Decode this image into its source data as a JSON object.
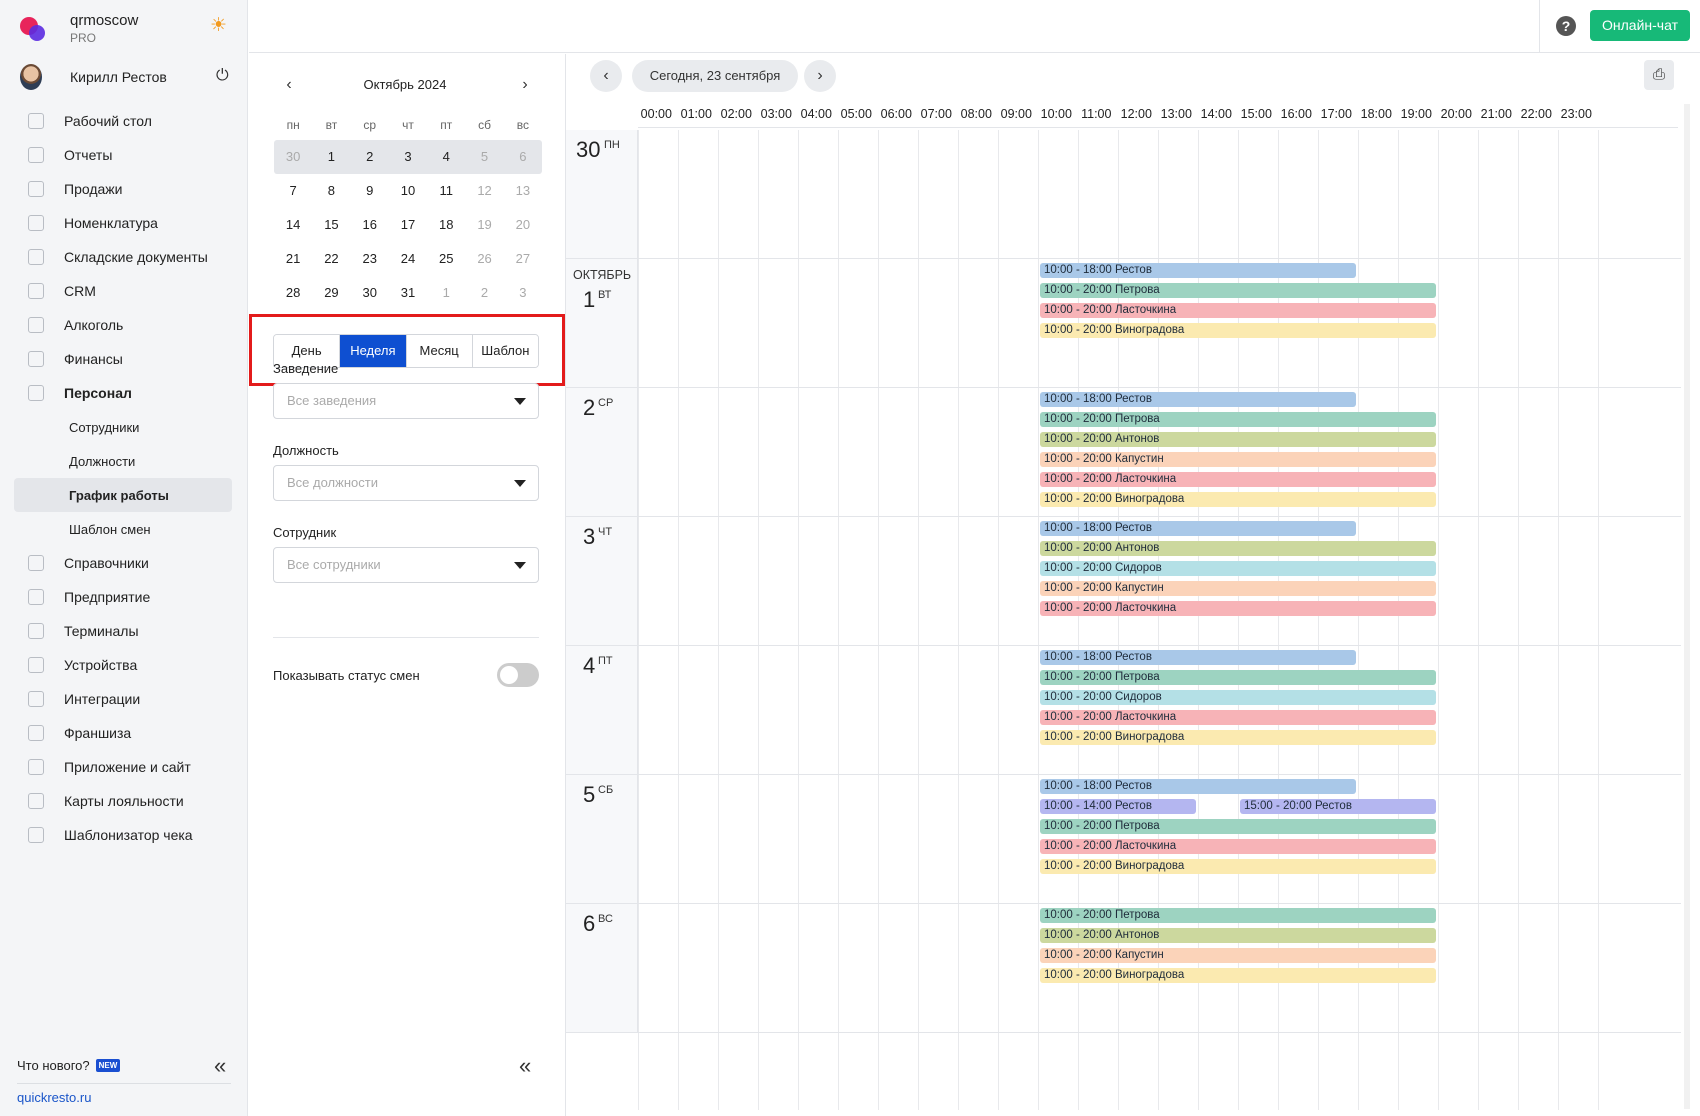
{
  "brand": {
    "name": "qrmoscow",
    "plan": "PRO"
  },
  "user": {
    "name": "Кирилл Рестов"
  },
  "nav": [
    {
      "label": "Рабочий стол",
      "icon": "dashboard-icon"
    },
    {
      "label": "Отчеты",
      "icon": "reports-icon"
    },
    {
      "label": "Продажи",
      "icon": "sales-icon"
    },
    {
      "label": "Номенклатура",
      "icon": "nomenclature-icon"
    },
    {
      "label": "Складские документы",
      "icon": "warehouse-icon"
    },
    {
      "label": "CRM",
      "icon": "crm-icon"
    },
    {
      "label": "Алкоголь",
      "icon": "alcohol-icon"
    },
    {
      "label": "Финансы",
      "icon": "finance-icon"
    },
    {
      "label": "Персонал",
      "icon": "staff-icon",
      "bold": true
    }
  ],
  "nav_sub": [
    {
      "label": "Сотрудники"
    },
    {
      "label": "Должности"
    },
    {
      "label": "График работы",
      "active": true
    },
    {
      "label": "Шаблон смен"
    }
  ],
  "nav2": [
    {
      "label": "Справочники",
      "icon": "directory-icon"
    },
    {
      "label": "Предприятие",
      "icon": "enterprise-icon"
    },
    {
      "label": "Терминалы",
      "icon": "terminal-icon"
    },
    {
      "label": "Устройства",
      "icon": "printer-icon"
    },
    {
      "label": "Интеграции",
      "icon": "integration-icon"
    },
    {
      "label": "Франшиза",
      "icon": "franchise-icon"
    },
    {
      "label": "Приложение и сайт",
      "icon": "app-icon"
    },
    {
      "label": "Карты лояльности",
      "icon": "loyalty-icon"
    },
    {
      "label": "Шаблонизатор чека",
      "icon": "receipt-icon"
    }
  ],
  "footer": {
    "whats_new": "Что нового?",
    "new_badge": "NEW",
    "link": "quickresto.ru",
    "collapse": "«"
  },
  "topbar": {
    "help": "?",
    "chat": "Онлайн-чат"
  },
  "calendar": {
    "title": "Октябрь 2024",
    "prev": "‹",
    "next": "›",
    "dow": [
      "пн",
      "вт",
      "ср",
      "чт",
      "пт",
      "сб",
      "вс"
    ],
    "weeks": [
      {
        "sel": true,
        "days": [
          {
            "d": "30",
            "m": true
          },
          {
            "d": "1"
          },
          {
            "d": "2"
          },
          {
            "d": "3"
          },
          {
            "d": "4"
          },
          {
            "d": "5",
            "m": true
          },
          {
            "d": "6",
            "m": true
          }
        ]
      },
      {
        "days": [
          {
            "d": "7"
          },
          {
            "d": "8"
          },
          {
            "d": "9"
          },
          {
            "d": "10"
          },
          {
            "d": "11"
          },
          {
            "d": "12",
            "m": true
          },
          {
            "d": "13",
            "m": true
          }
        ]
      },
      {
        "days": [
          {
            "d": "14"
          },
          {
            "d": "15"
          },
          {
            "d": "16"
          },
          {
            "d": "17"
          },
          {
            "d": "18"
          },
          {
            "d": "19",
            "m": true
          },
          {
            "d": "20",
            "m": true
          }
        ]
      },
      {
        "days": [
          {
            "d": "21"
          },
          {
            "d": "22"
          },
          {
            "d": "23"
          },
          {
            "d": "24"
          },
          {
            "d": "25"
          },
          {
            "d": "26",
            "m": true
          },
          {
            "d": "27",
            "m": true
          }
        ]
      },
      {
        "days": [
          {
            "d": "28"
          },
          {
            "d": "29"
          },
          {
            "d": "30"
          },
          {
            "d": "31"
          },
          {
            "d": "1",
            "m": true
          },
          {
            "d": "2",
            "m": true
          },
          {
            "d": "3",
            "m": true
          }
        ]
      }
    ]
  },
  "views": [
    {
      "label": "День"
    },
    {
      "label": "Неделя",
      "active": true
    },
    {
      "label": "Месяц"
    },
    {
      "label": "Шаблон"
    }
  ],
  "filters": {
    "venue_label": "Заведение",
    "venue_placeholder": "Все заведения",
    "position_label": "Должность",
    "position_placeholder": "Все должности",
    "employee_label": "Сотрудник",
    "employee_placeholder": "Все сотрудники",
    "toggle_label": "Показывать статус смен",
    "toggle_on": false
  },
  "schedule": {
    "today": "Сегодня, 23 сентября",
    "prev": "‹",
    "next": "›",
    "print": "⎙",
    "hours": [
      "00:00",
      "01:00",
      "02:00",
      "03:00",
      "04:00",
      "05:00",
      "06:00",
      "07:00",
      "08:00",
      "09:00",
      "10:00",
      "11:00",
      "12:00",
      "13:00",
      "14:00",
      "15:00",
      "16:00",
      "17:00",
      "18:00",
      "19:00",
      "20:00",
      "21:00",
      "22:00",
      "23:00"
    ],
    "colors": {
      "blue": "#a9c8e8",
      "green": "#9dd3c1",
      "red": "#f7b3b7",
      "yellow": "#fbeab0",
      "olive": "#ccd89e",
      "peach": "#fbd3b9",
      "cyan": "#b4e0e6",
      "purple": "#b4b6f0"
    },
    "days": [
      {
        "num": "30",
        "dow": "ПН",
        "month": "",
        "shifts": []
      },
      {
        "num": "1",
        "dow": "ВТ",
        "month": "ОКТЯБРЬ",
        "shifts": [
          {
            "text": "10:00 - 18:00 Рестов",
            "start": 10,
            "end": 18,
            "color": "blue"
          },
          {
            "text": "10:00 - 20:00 Петрова",
            "start": 10,
            "end": 20,
            "color": "green"
          },
          {
            "text": "10:00 - 20:00 Ласточкина",
            "start": 10,
            "end": 20,
            "color": "red"
          },
          {
            "text": "10:00 - 20:00 Виноградова",
            "start": 10,
            "end": 20,
            "color": "yellow"
          }
        ]
      },
      {
        "num": "2",
        "dow": "СР",
        "month": "",
        "shifts": [
          {
            "text": "10:00 - 18:00 Рестов",
            "start": 10,
            "end": 18,
            "color": "blue"
          },
          {
            "text": "10:00 - 20:00 Петрова",
            "start": 10,
            "end": 20,
            "color": "green"
          },
          {
            "text": "10:00 - 20:00 Антонов",
            "start": 10,
            "end": 20,
            "color": "olive"
          },
          {
            "text": "10:00 - 20:00 Капустин",
            "start": 10,
            "end": 20,
            "color": "peach"
          },
          {
            "text": "10:00 - 20:00 Ласточкина",
            "start": 10,
            "end": 20,
            "color": "red"
          },
          {
            "text": "10:00 - 20:00 Виноградова",
            "start": 10,
            "end": 20,
            "color": "yellow"
          }
        ]
      },
      {
        "num": "3",
        "dow": "ЧТ",
        "month": "",
        "shifts": [
          {
            "text": "10:00 - 18:00 Рестов",
            "start": 10,
            "end": 18,
            "color": "blue"
          },
          {
            "text": "10:00 - 20:00 Антонов",
            "start": 10,
            "end": 20,
            "color": "olive"
          },
          {
            "text": "10:00 - 20:00 Сидоров",
            "start": 10,
            "end": 20,
            "color": "cyan"
          },
          {
            "text": "10:00 - 20:00 Капустин",
            "start": 10,
            "end": 20,
            "color": "peach"
          },
          {
            "text": "10:00 - 20:00 Ласточкина",
            "start": 10,
            "end": 20,
            "color": "red"
          }
        ]
      },
      {
        "num": "4",
        "dow": "ПТ",
        "month": "",
        "shifts": [
          {
            "text": "10:00 - 18:00 Рестов",
            "start": 10,
            "end": 18,
            "color": "blue"
          },
          {
            "text": "10:00 - 20:00 Петрова",
            "start": 10,
            "end": 20,
            "color": "green"
          },
          {
            "text": "10:00 - 20:00 Сидоров",
            "start": 10,
            "end": 20,
            "color": "cyan"
          },
          {
            "text": "10:00 - 20:00 Ласточкина",
            "start": 10,
            "end": 20,
            "color": "red"
          },
          {
            "text": "10:00 - 20:00 Виноградова",
            "start": 10,
            "end": 20,
            "color": "yellow"
          }
        ]
      },
      {
        "num": "5",
        "dow": "СБ",
        "month": "",
        "shifts": [
          {
            "text": "10:00 - 18:00 Рестов",
            "start": 10,
            "end": 18,
            "color": "blue"
          },
          {
            "text": "10:00 - 14:00 Рестов",
            "start": 10,
            "end": 14,
            "color": "purple"
          },
          {
            "text": "15:00 - 20:00 Рестов",
            "start": 15,
            "end": 20,
            "color": "purple",
            "same_line": true
          },
          {
            "text": "10:00 - 20:00 Петрова",
            "start": 10,
            "end": 20,
            "color": "green"
          },
          {
            "text": "10:00 - 20:00 Ласточкина",
            "start": 10,
            "end": 20,
            "color": "red"
          },
          {
            "text": "10:00 - 20:00 Виноградова",
            "start": 10,
            "end": 20,
            "color": "yellow"
          }
        ]
      },
      {
        "num": "6",
        "dow": "ВС",
        "month": "",
        "shifts": [
          {
            "text": "10:00 - 20:00 Петрова",
            "start": 10,
            "end": 20,
            "color": "green"
          },
          {
            "text": "10:00 - 20:00 Антонов",
            "start": 10,
            "end": 20,
            "color": "olive"
          },
          {
            "text": "10:00 - 20:00 Капустин",
            "start": 10,
            "end": 20,
            "color": "peach"
          },
          {
            "text": "10:00 - 20:00 Виноградова",
            "start": 10,
            "end": 20,
            "color": "yellow"
          }
        ]
      }
    ]
  }
}
